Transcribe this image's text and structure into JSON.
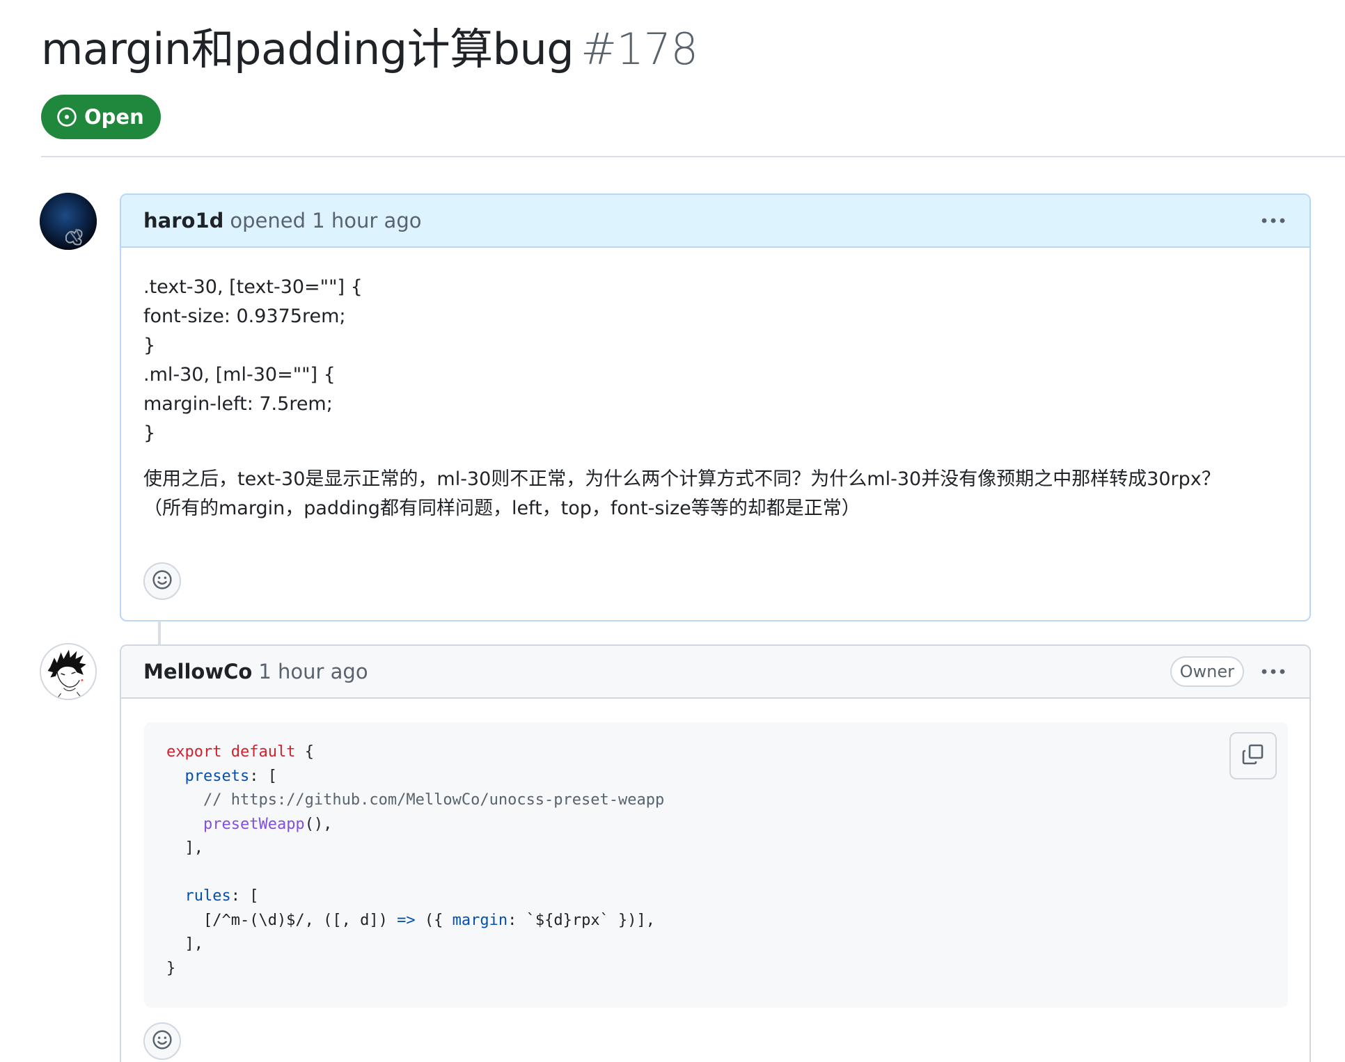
{
  "issue": {
    "title": "margin和padding计算bug",
    "number": "#178",
    "state": "Open"
  },
  "comments": [
    {
      "author": "haro1d",
      "meta": "opened 1 hour ago",
      "body_lines": [
        ".text-30, [text-30=\"\"] {",
        "font-size: 0.9375rem;",
        "}",
        ".ml-30, [ml-30=\"\"] {",
        "margin-left: 7.5rem;",
        "}"
      ],
      "paragraph": [
        "使用之后，text-30是显示正常的，ml-30则不正常，为什么两个计算方式不同？为什么ml-30并没有像预期之中那样转成30rpx？",
        "（所有的margin，padding都有同样问题，left，top，font-size等等的却都是正常）"
      ]
    },
    {
      "author": "MellowCo",
      "meta": "1 hour ago",
      "role_label": "Owner",
      "code_lines": [
        "export default {",
        "  presets: [",
        "    // https://github.com/MellowCo/unocss-preset-weapp",
        "    presetWeapp(),",
        "  ],",
        "",
        "  rules: [",
        "    [/^m-(\\d)$/, ([, d]) => ({ margin: `${d}rpx` })],",
        "  ],",
        "}"
      ]
    }
  ],
  "icons": {
    "state": "issue-opened-icon",
    "menu": "kebab-horizontal-icon",
    "reaction": "smiley-icon",
    "copy": "copy-icon"
  },
  "colors": {
    "open_green": "#1f883d",
    "author_header_bg": "#ddf4ff",
    "author_border": "#b6d7f5",
    "keyword_red": "#cf222e",
    "property_blue": "#0550ae",
    "function_purple": "#8250df",
    "comment_gray": "#59636e"
  }
}
